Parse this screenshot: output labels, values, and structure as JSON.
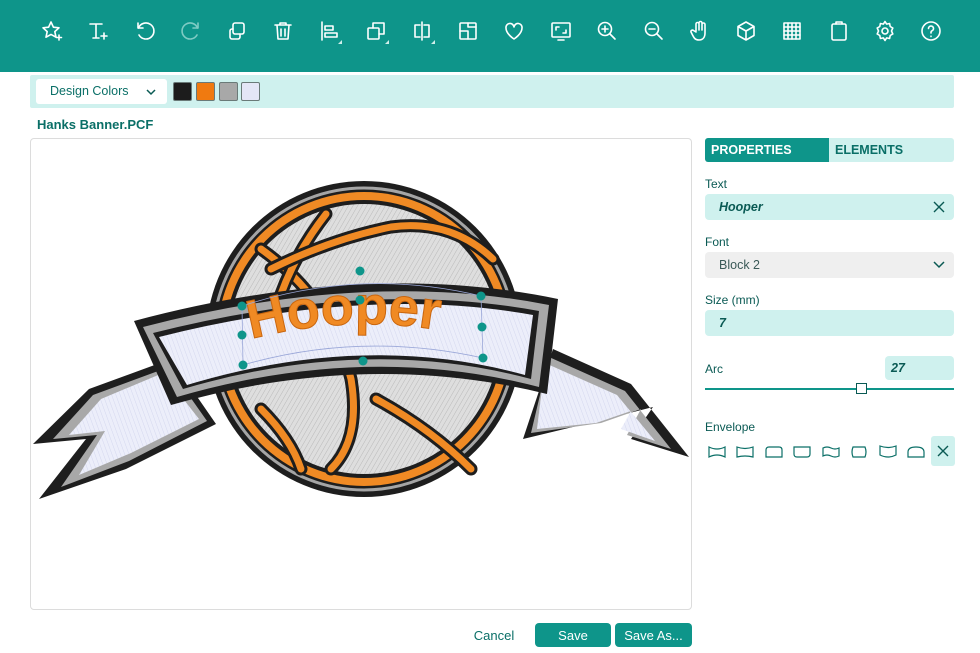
{
  "toolbar": {
    "icons": [
      "add-shape-icon",
      "add-text-icon",
      "undo-icon",
      "redo-icon",
      "duplicate-icon",
      "delete-icon",
      "align-icon",
      "arrange-icon",
      "mirror-icon",
      "resize-icon",
      "favorite-icon",
      "fit-to-screen-icon",
      "zoom-in-icon",
      "zoom-out-icon",
      "pan-hand-icon",
      "3d-view-icon",
      "grid-icon",
      "clipboard-icon",
      "settings-icon",
      "help-icon"
    ]
  },
  "colorbar": {
    "dropdown_label": "Design Colors",
    "swatches": [
      "#1c1c1c",
      "#f07a10",
      "#a8a8a8",
      "#e4e6f6"
    ]
  },
  "document": {
    "filename": "Hanks Banner.PCF"
  },
  "design": {
    "text": "Hooper",
    "text_color": "#f08a24",
    "outline_color": "#1e1e1e",
    "fill_gray": "#d0d0d0",
    "ribbon_fill": "#e8eaf8"
  },
  "panel": {
    "tabs": [
      {
        "label": "PROPERTIES",
        "active": true
      },
      {
        "label": "ELEMENTS",
        "active": false
      }
    ],
    "text_label": "Text",
    "text_value": "Hooper",
    "font_label": "Font",
    "font_value": "Block 2",
    "size_label": "Size (mm)",
    "size_value": "7",
    "arc_label": "Arc",
    "arc_value": "27",
    "envelope_label": "Envelope",
    "envelopes": [
      "envelope-arch-down-icon",
      "envelope-arch-up-icon",
      "envelope-round-top-icon",
      "envelope-round-bottom-icon",
      "envelope-wave-icon",
      "envelope-barrel-icon",
      "envelope-pinch-icon",
      "envelope-bridge-icon"
    ]
  },
  "footer": {
    "cancel_label": "Cancel",
    "save_label": "Save",
    "save_as_label": "Save As..."
  }
}
